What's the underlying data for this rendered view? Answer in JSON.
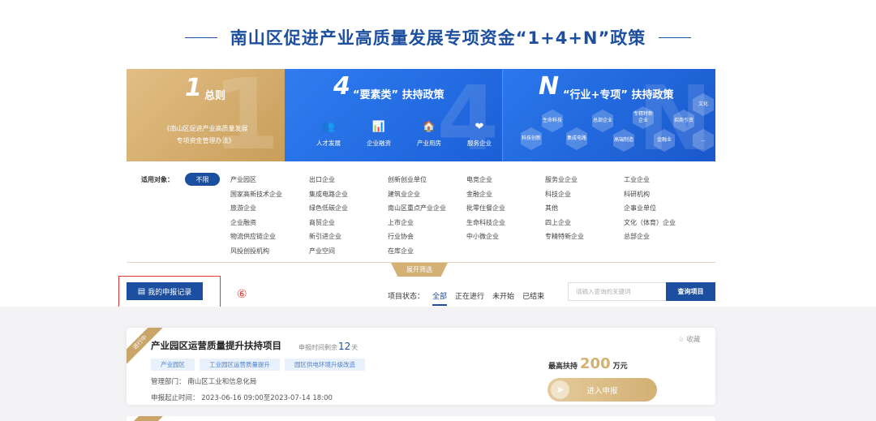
{
  "page": {
    "title": "南山区促进产业高质量发展专项资金“1+4+N”政策"
  },
  "banner": {
    "general": {
      "number": "1",
      "label": "总则",
      "ghost": "1",
      "desc_line1": "《南山区促进产业高质量发展",
      "desc_line2": "专项资金管理办法》"
    },
    "factor": {
      "number": "4",
      "label": "“要素类” 扶持政策",
      "ghost": "4",
      "items": [
        {
          "glyph": "👥",
          "label": "人才发展"
        },
        {
          "glyph": "📊",
          "label": "企业融资"
        },
        {
          "glyph": "🏠",
          "label": "产业用房"
        },
        {
          "glyph": "❤",
          "label": "服务企业"
        }
      ]
    },
    "industry": {
      "number": "N",
      "label": "“行业+专项” 扶持政策",
      "ghost": "N",
      "hexes": [
        "科技创新",
        "生命科技",
        "集成电路",
        "总部企业",
        "高端制造",
        "专精特新企业",
        "金融业",
        "招商引资",
        "文化",
        "..."
      ]
    }
  },
  "filter": {
    "label": "适用对象：",
    "all_label": "不限",
    "tags": [
      "产业园区",
      "出口企业",
      "创新创业单位",
      "电竞企业",
      "服务业企业",
      "工业企业",
      "国家高新技术企业",
      "集成电路企业",
      "建筑业企业",
      "金融企业",
      "科技企业",
      "科研机构",
      "旅游企业",
      "绿色低碳企业",
      "南山区重点产业企业",
      "批零住餐企业",
      "其他",
      "企事业单位",
      "企业融资",
      "商贸企业",
      "上市企业",
      "生命科技企业",
      "四上企业",
      "文化（体育）企业",
      "物流供应链企业",
      "新引进企业",
      "行业协会",
      "中小微企业",
      "专精特新企业",
      "总部企业",
      "风投创投机构",
      "产业空间",
      "在库企业",
      "",
      "",
      ""
    ],
    "expand_label": "展开筛选"
  },
  "toolbar": {
    "my_records_label": "我的申报记录",
    "annotation": "⑥",
    "status_label": "项目状态：",
    "statuses": [
      "全部",
      "正在进行",
      "未开始",
      "已结束"
    ],
    "search_placeholder": "请输入查询的关键词",
    "search_button": "查询项目"
  },
  "project": {
    "ribbon": "进行中",
    "title": "产业园区运营质量提升扶持项目",
    "deadline_prefix": "申报时间剩余",
    "deadline_days": "12",
    "deadline_suffix": "天",
    "tags": [
      "产业园区",
      "工业园区运营质量提升",
      "园区供电环境升级改造"
    ],
    "dept": "管理部门：  南山区工业和信息化局",
    "dates": "申报起止时间：  2023-06-16 09:00至2023-07-14 18:00",
    "favorite": "☆ 收藏",
    "max_prefix": "最高扶持",
    "max_amount": "200",
    "max_unit": "万元",
    "apply_label": "进入申报"
  },
  "colors": {
    "primary": "#1d4fa0",
    "gold": "#d3b074",
    "annotation_red": "#e53935"
  }
}
